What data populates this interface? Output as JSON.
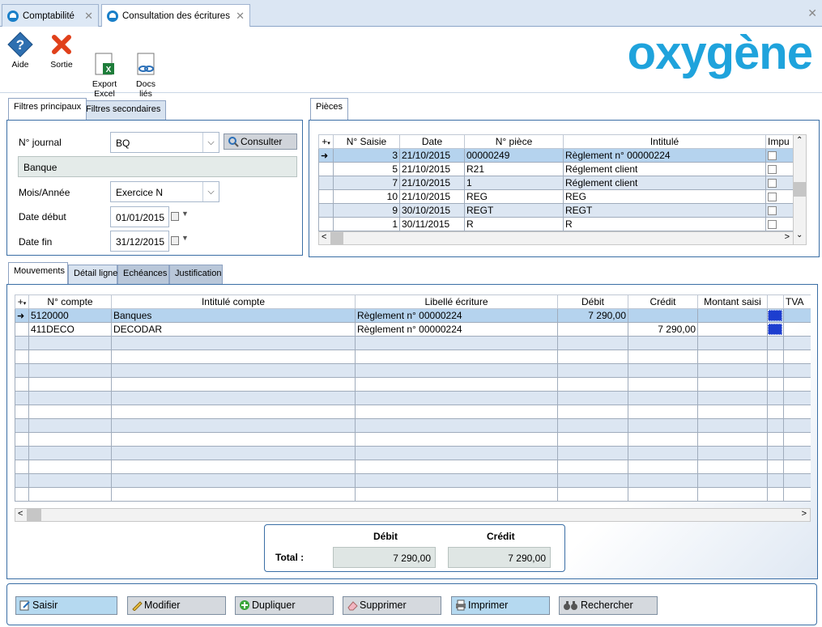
{
  "tabs": [
    {
      "label": "Comptabilité",
      "active": false
    },
    {
      "label": "Consultation des écritures",
      "active": true
    }
  ],
  "toolbar": {
    "aide": "Aide",
    "sortie": "Sortie",
    "export": "Export\nExcel",
    "docs": "Docs\nliés"
  },
  "logo": "oxygène",
  "filters": {
    "tab_main": "Filtres principaux",
    "tab_secondary": "Filtres secondaires",
    "journal_label": "N° journal",
    "journal_value": "BQ",
    "consult_button": "Consulter",
    "journal_name": "Banque",
    "period_label": "Mois/Année",
    "period_value": "Exercice N",
    "start_label": "Date début",
    "start_value": "01/01/2015",
    "end_label": "Date fin",
    "end_value": "31/12/2015"
  },
  "pieces": {
    "tab": "Pièces",
    "columns": [
      "N° Saisie",
      "Date",
      "N° pièce",
      "Intitulé",
      "Impu"
    ],
    "rows": [
      {
        "saisie": "3",
        "date": "21/10/2015",
        "piece": "00000249",
        "intitule": "Règlement n° 00000224"
      },
      {
        "saisie": "5",
        "date": "21/10/2015",
        "piece": "R21",
        "intitule": "Réglement client"
      },
      {
        "saisie": "7",
        "date": "21/10/2015",
        "piece": "1",
        "intitule": "Réglement client"
      },
      {
        "saisie": "10",
        "date": "21/10/2015",
        "piece": "REG",
        "intitule": "REG"
      },
      {
        "saisie": "9",
        "date": "30/10/2015",
        "piece": "REGT",
        "intitule": "REGT"
      },
      {
        "saisie": "1",
        "date": "30/11/2015",
        "piece": "R",
        "intitule": "R"
      }
    ]
  },
  "movements": {
    "tabs": [
      "Mouvements",
      "Détail ligne",
      "Echéances",
      "Justification"
    ],
    "columns": [
      "N° compte",
      "Intitulé compte",
      "Libellé écriture",
      "Débit",
      "Crédit",
      "Montant saisi",
      "TVA"
    ],
    "rows": [
      {
        "compte": "5120000",
        "intitule": "Banques",
        "libelle": "Règlement n° 00000224",
        "debit": "7 290,00",
        "credit": ""
      },
      {
        "compte": "411DECO",
        "intitule": "DECODAR",
        "libelle": "Règlement n° 00000224",
        "debit": "",
        "credit": "7 290,00"
      }
    ]
  },
  "totals": {
    "debit_label": "Débit",
    "credit_label": "Crédit",
    "total_label": "Total :",
    "debit": "7 290,00",
    "credit": "7 290,00"
  },
  "actions": {
    "saisir": "Saisir",
    "modifier": "Modifier",
    "dupliquer": "Dupliquer",
    "supprimer": "Supprimer",
    "imprimer": "Imprimer",
    "rechercher": "Rechercher"
  },
  "colors": {
    "accent": "#1fa3dc",
    "panel_border": "#3a6ea5",
    "row_alt": "#dce6f2",
    "row_selected": "#b5d3ee"
  }
}
